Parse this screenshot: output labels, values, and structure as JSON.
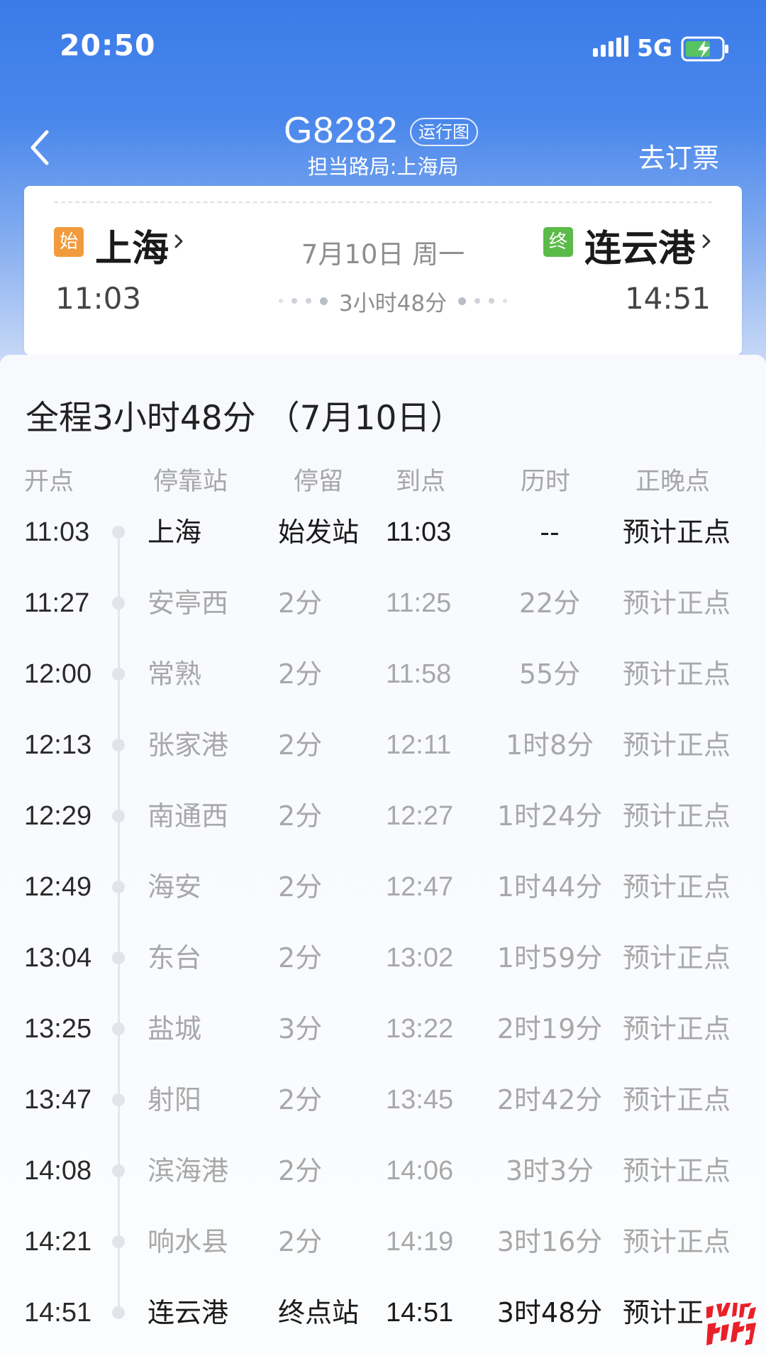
{
  "status_bar": {
    "time": "20:50",
    "network": "5G",
    "icons": [
      "signal-icon",
      "battery-charging-icon"
    ]
  },
  "nav": {
    "train_number": "G8282",
    "diagram_link": "运行图",
    "operator": "担当路局:上海局",
    "book_ticket": "去订票",
    "back_icon": "chevron-left-icon"
  },
  "summary": {
    "start_badge": "始",
    "end_badge": "终",
    "from_station": "上海",
    "to_station": "连云港",
    "date": "7月10日 周一",
    "depart_time": "11:03",
    "arrive_time": "14:51",
    "duration": "3小时48分",
    "colors": {
      "start_badge": "#f29b3d",
      "end_badge": "#5bbb4a"
    }
  },
  "schedule": {
    "title": "全程3小时48分 （7月10日）",
    "headers": {
      "depart": "开点",
      "station": "停靠站",
      "stop": "停留",
      "arrive": "到点",
      "elapsed": "历时",
      "punctuality": "正晚点"
    },
    "rows": [
      {
        "depart": "11:03",
        "station": "上海",
        "stop": "始发站",
        "arrive": "11:03",
        "elapsed": "--",
        "punctuality": "预计正点"
      },
      {
        "depart": "11:27",
        "station": "安亭西",
        "stop": "2分",
        "arrive": "11:25",
        "elapsed": "22分",
        "punctuality": "预计正点"
      },
      {
        "depart": "12:00",
        "station": "常熟",
        "stop": "2分",
        "arrive": "11:58",
        "elapsed": "55分",
        "punctuality": "预计正点"
      },
      {
        "depart": "12:13",
        "station": "张家港",
        "stop": "2分",
        "arrive": "12:11",
        "elapsed": "1时8分",
        "punctuality": "预计正点"
      },
      {
        "depart": "12:29",
        "station": "南通西",
        "stop": "2分",
        "arrive": "12:27",
        "elapsed": "1时24分",
        "punctuality": "预计正点"
      },
      {
        "depart": "12:49",
        "station": "海安",
        "stop": "2分",
        "arrive": "12:47",
        "elapsed": "1时44分",
        "punctuality": "预计正点"
      },
      {
        "depart": "13:04",
        "station": "东台",
        "stop": "2分",
        "arrive": "13:02",
        "elapsed": "1时59分",
        "punctuality": "预计正点"
      },
      {
        "depart": "13:25",
        "station": "盐城",
        "stop": "3分",
        "arrive": "13:22",
        "elapsed": "2时19分",
        "punctuality": "预计正点"
      },
      {
        "depart": "13:47",
        "station": "射阳",
        "stop": "2分",
        "arrive": "13:45",
        "elapsed": "2时42分",
        "punctuality": "预计正点"
      },
      {
        "depart": "14:08",
        "station": "滨海港",
        "stop": "2分",
        "arrive": "14:06",
        "elapsed": "3时3分",
        "punctuality": "预计正点"
      },
      {
        "depart": "14:21",
        "station": "响水县",
        "stop": "2分",
        "arrive": "14:19",
        "elapsed": "3时16分",
        "punctuality": "预计正点"
      },
      {
        "depart": "14:51",
        "station": "连云港",
        "stop": "终点站",
        "arrive": "14:51",
        "elapsed": "3时48分",
        "punctuality": "预计正"
      }
    ]
  },
  "watermark": {
    "text": "响水热门"
  }
}
